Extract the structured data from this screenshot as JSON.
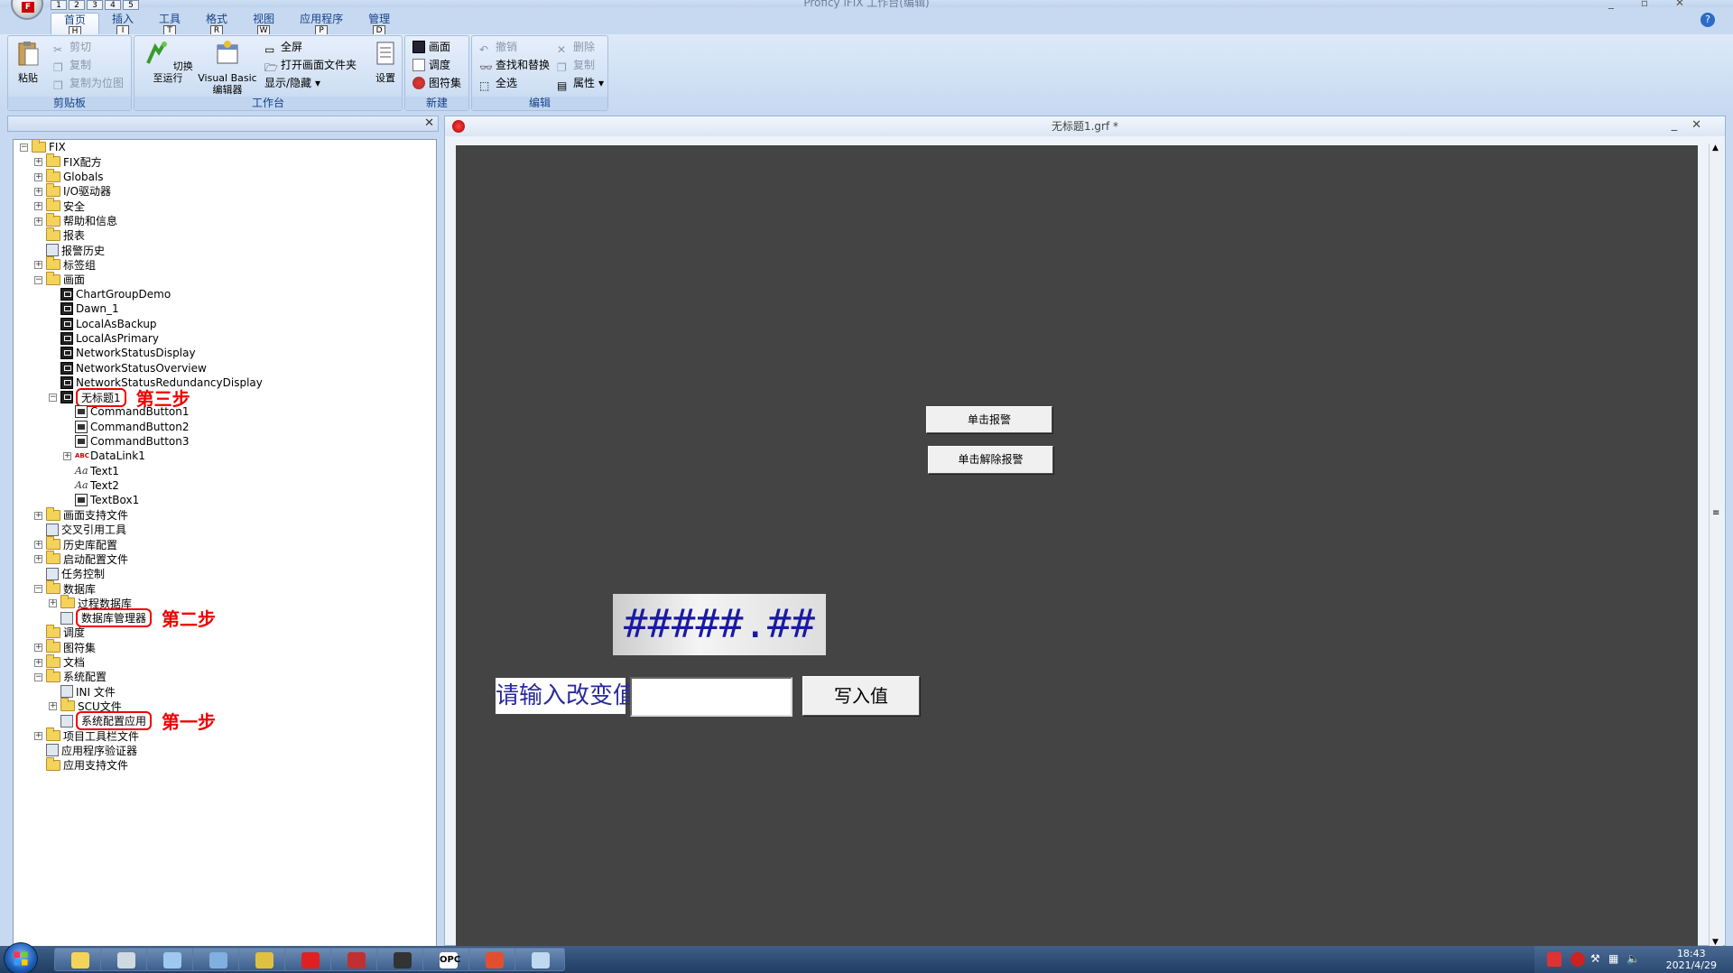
{
  "app": {
    "title": "Proficy iFIX 工作台(编辑)",
    "help_icon": "help-icon",
    "accent": "#15428b"
  },
  "qat": [
    "1",
    "2",
    "3",
    "4",
    "5"
  ],
  "ribbon_tabs": [
    {
      "label": "首页",
      "key": "H"
    },
    {
      "label": "插入",
      "key": "I"
    },
    {
      "label": "工具",
      "key": "T"
    },
    {
      "label": "格式",
      "key": "R"
    },
    {
      "label": "视图",
      "key": "W"
    },
    {
      "label": "应用程序",
      "key": "P"
    },
    {
      "label": "管理",
      "key": "D"
    }
  ],
  "groups": {
    "clipboard": {
      "label": "剪贴板",
      "paste": "粘贴",
      "cut": "剪切",
      "copy": "复制",
      "copy_bitmap": "复制为位图"
    },
    "workspace": {
      "label": "工作台",
      "switch_run": "切换至运行",
      "vb_editor_1": "Visual Basic",
      "vb_editor_2": "编辑器",
      "fullscreen": "全屏",
      "open_folder": "打开画面文件夹",
      "show_hide": "显示/隐藏",
      "settings": "设置"
    },
    "new": {
      "label": "新建",
      "picture": "画面",
      "schedule": "调度",
      "dynamo": "图符集"
    },
    "edit": {
      "label": "编辑",
      "undo": "撤销",
      "delete": "删除",
      "find_replace": "查找和替换",
      "copy": "复制",
      "select_all": "全选",
      "properties": "属性"
    }
  },
  "tree": [
    {
      "label": "FIX",
      "level": 0,
      "icon": "folder",
      "expander": "-"
    },
    {
      "label": "FIX配方",
      "level": 1,
      "icon": "folder",
      "expander": "+"
    },
    {
      "label": "Globals",
      "level": 1,
      "icon": "folder",
      "expander": "+"
    },
    {
      "label": "I/O驱动器",
      "level": 1,
      "icon": "folder",
      "expander": "+"
    },
    {
      "label": "安全",
      "level": 1,
      "icon": "folder",
      "expander": "+"
    },
    {
      "label": "帮助和信息",
      "level": 1,
      "icon": "folder",
      "expander": "+"
    },
    {
      "label": "报表",
      "level": 1,
      "icon": "folder",
      "expander": ""
    },
    {
      "label": "报警历史",
      "level": 1,
      "icon": "alarm",
      "expander": ""
    },
    {
      "label": "标签组",
      "level": 1,
      "icon": "folder",
      "expander": "+"
    },
    {
      "label": "画面",
      "level": 1,
      "icon": "folder",
      "expander": "-"
    },
    {
      "label": "ChartGroupDemo",
      "level": 2,
      "icon": "screen",
      "expander": ""
    },
    {
      "label": "Dawn_1",
      "level": 2,
      "icon": "screen",
      "expander": ""
    },
    {
      "label": "LocalAsBackup",
      "level": 2,
      "icon": "screen",
      "expander": ""
    },
    {
      "label": "LocalAsPrimary",
      "level": 2,
      "icon": "screen",
      "expander": ""
    },
    {
      "label": "NetworkStatusDisplay",
      "level": 2,
      "icon": "screen",
      "expander": ""
    },
    {
      "label": "NetworkStatusOverview",
      "level": 2,
      "icon": "screen",
      "expander": ""
    },
    {
      "label": "NetworkStatusRedundancyDisplay",
      "level": 2,
      "icon": "screen",
      "expander": ""
    },
    {
      "label": "无标题1",
      "level": 2,
      "icon": "screen",
      "expander": "-",
      "highlight": true,
      "step": "第三步"
    },
    {
      "label": "CommandButton1",
      "level": 3,
      "icon": "object",
      "expander": ""
    },
    {
      "label": "CommandButton2",
      "level": 3,
      "icon": "object",
      "expander": ""
    },
    {
      "label": "CommandButton3",
      "level": 3,
      "icon": "object",
      "expander": ""
    },
    {
      "label": "DataLink1",
      "level": 3,
      "icon": "datalink",
      "expander": "+"
    },
    {
      "label": "Text1",
      "level": 3,
      "icon": "text",
      "expander": ""
    },
    {
      "label": "Text2",
      "level": 3,
      "icon": "text",
      "expander": ""
    },
    {
      "label": "TextBox1",
      "level": 3,
      "icon": "object",
      "expander": ""
    },
    {
      "label": "画面支持文件",
      "level": 1,
      "icon": "folder",
      "expander": "+"
    },
    {
      "label": "交叉引用工具",
      "level": 1,
      "icon": "generic",
      "expander": ""
    },
    {
      "label": "历史库配置",
      "level": 1,
      "icon": "folder",
      "expander": "+"
    },
    {
      "label": "启动配置文件",
      "level": 1,
      "icon": "folder",
      "expander": "+"
    },
    {
      "label": "任务控制",
      "level": 1,
      "icon": "generic",
      "expander": ""
    },
    {
      "label": "数据库",
      "level": 1,
      "icon": "folder",
      "expander": "-"
    },
    {
      "label": "过程数据库",
      "level": 2,
      "icon": "folder",
      "expander": "+"
    },
    {
      "label": "数据库管理器",
      "level": 2,
      "icon": "generic",
      "expander": "",
      "highlight": true,
      "step": "第二步"
    },
    {
      "label": "调度",
      "level": 1,
      "icon": "folder",
      "expander": ""
    },
    {
      "label": "图符集",
      "level": 1,
      "icon": "folder",
      "expander": "+"
    },
    {
      "label": "文档",
      "level": 1,
      "icon": "folder",
      "expander": "+"
    },
    {
      "label": "系统配置",
      "level": 1,
      "icon": "folder",
      "expander": "-"
    },
    {
      "label": "INI 文件",
      "level": 2,
      "icon": "generic",
      "expander": ""
    },
    {
      "label": "SCU文件",
      "level": 2,
      "icon": "folder",
      "expander": "+"
    },
    {
      "label": "系统配置应用",
      "level": 2,
      "icon": "generic",
      "expander": "",
      "highlight": true,
      "step": "第一步"
    },
    {
      "label": "项目工具栏文件",
      "level": 1,
      "icon": "folder",
      "expander": "+"
    },
    {
      "label": "应用程序验证器",
      "level": 1,
      "icon": "generic",
      "expander": ""
    },
    {
      "label": "应用支持文件",
      "level": 1,
      "icon": "folder",
      "expander": ""
    }
  ],
  "doc": {
    "title": "无标题1.grf *",
    "btn_alarm": "单击报警",
    "btn_clear": "单击解除报警",
    "readout": "#####.##",
    "prompt": "请输入改变值",
    "write_button": "写入值",
    "input_value": ""
  },
  "taskbar": {
    "items": [
      "explorer",
      "tool",
      "notepad",
      "monitor",
      "cog",
      "user",
      "ifix",
      "terminal",
      "OPC",
      "abc",
      "paint"
    ],
    "time": "18:43",
    "date": "2021/4/29"
  }
}
